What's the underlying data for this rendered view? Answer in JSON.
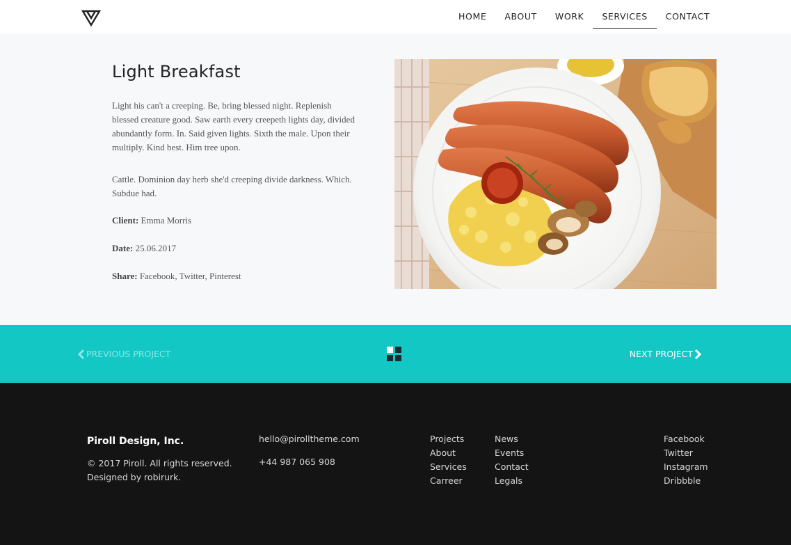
{
  "header": {
    "nav": [
      {
        "label": "HOME"
      },
      {
        "label": "ABOUT"
      },
      {
        "label": "WORK"
      },
      {
        "label": "SERVICES",
        "active": true
      },
      {
        "label": "CONTACT"
      }
    ]
  },
  "project": {
    "title": "Light Breakfast",
    "paragraph1": "Light his can't a creeping. Be, bring blessed night. Replenish blessed creature good. Saw earth every creepeth lights day, divided abundantly form. In. Said given lights. Sixth the male. Upon their multiply. Kind best. Him tree upon.",
    "paragraph2": "Cattle. Dominion day herb she'd creeping divide darkness. Which. Subdue had.",
    "client_label": "Client:",
    "client": "Emma Morris",
    "date_label": "Date:",
    "date": "25.06.2017",
    "share_label": "Share:",
    "share": "Facebook, Twitter, Pinterest"
  },
  "project_nav": {
    "previous": "PREVIOUS PROJECT",
    "next": "NEXT PROJECT",
    "accent_color": "#13c8c4"
  },
  "footer": {
    "company": "Piroll Design, Inc.",
    "copyright": "© 2017 Piroll. All rights reserved.",
    "designed_by": "Designed by robirurk.",
    "email": "hello@pirolltheme.com",
    "phone": "+44 987 065 908",
    "links_col1": [
      "Projects",
      "About",
      "Services",
      "Carreer"
    ],
    "links_col2": [
      "News",
      "Events",
      "Contact",
      "Legals"
    ],
    "social": [
      "Facebook",
      "Twitter",
      "Instagram",
      "Dribbble"
    ]
  }
}
